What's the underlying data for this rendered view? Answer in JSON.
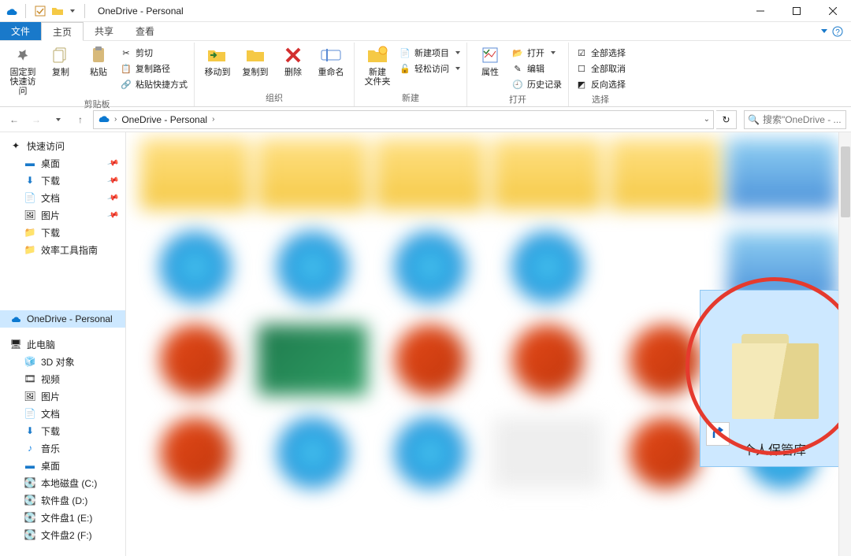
{
  "window": {
    "title": "OneDrive - Personal"
  },
  "tabs": {
    "file": "文件",
    "home": "主页",
    "share": "共享",
    "view": "查看"
  },
  "ribbon": {
    "clipboard": {
      "label": "剪贴板",
      "pin": "固定到\n快速访问",
      "copy": "复制",
      "paste": "粘贴",
      "cut": "剪切",
      "copy_path": "复制路径",
      "paste_shortcut": "粘贴快捷方式"
    },
    "organize": {
      "label": "组织",
      "move": "移动到",
      "copy_to": "复制到",
      "delete": "删除",
      "rename": "重命名"
    },
    "new": {
      "label": "新建",
      "new_folder": "新建\n文件夹",
      "new_item": "新建项目",
      "easy_access": "轻松访问"
    },
    "open": {
      "label": "打开",
      "properties": "属性",
      "open": "打开",
      "edit": "编辑",
      "history": "历史记录"
    },
    "select": {
      "label": "选择",
      "select_all": "全部选择",
      "select_none": "全部取消",
      "invert": "反向选择"
    }
  },
  "address": {
    "root": "OneDrive - Personal"
  },
  "search": {
    "placeholder": "搜索\"OneDrive - ..."
  },
  "sidebar": {
    "quick": "快速访问",
    "desktop": "桌面",
    "downloads": "下载",
    "documents": "文档",
    "pictures": "图片",
    "downloads2": "下载",
    "efficiency": "效率工具指南",
    "onedrive": "OneDrive - Personal",
    "thispc": "此电脑",
    "d3": "3D 对象",
    "videos": "视频",
    "pictures2": "图片",
    "documents2": "文档",
    "downloads3": "下载",
    "music": "音乐",
    "desktop2": "桌面",
    "cdrive": "本地磁盘 (C:)",
    "ddrive": "软件盘 (D:)",
    "edrive": "文件盘1 (E:)",
    "fdrive": "文件盘2 (F:)"
  },
  "highlight": {
    "vault": "个人保管库"
  }
}
